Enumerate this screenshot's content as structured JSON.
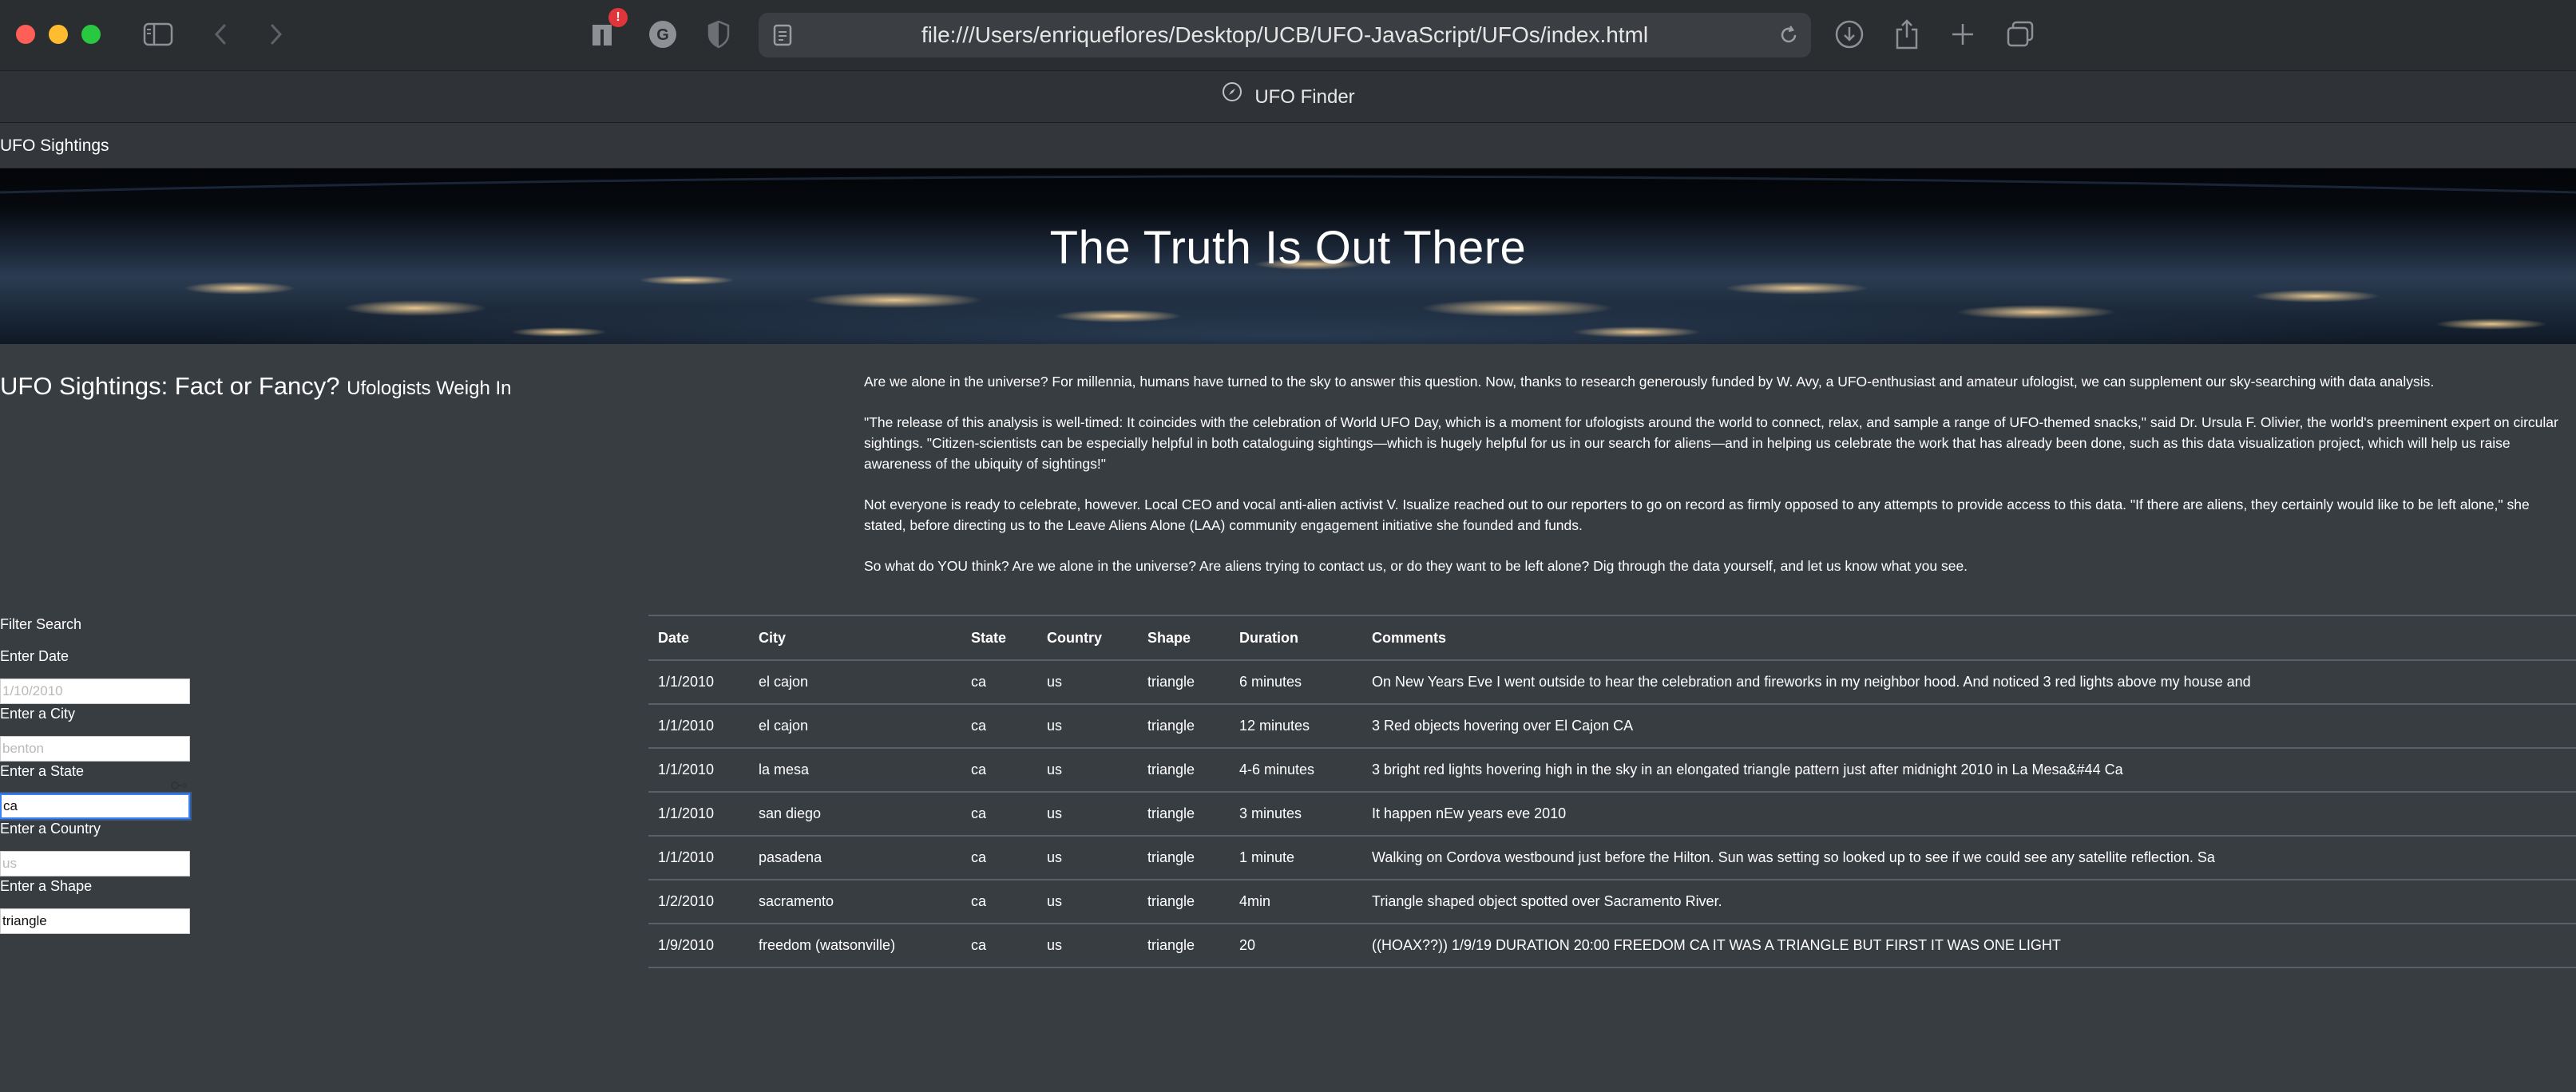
{
  "browser": {
    "url": "file:///Users/enriqueflores/Desktop/UCB/UFO-JavaScript/UFOs/index.html",
    "tab_title": "UFO Finder",
    "notification_badge": "!"
  },
  "navbar": {
    "brand": "UFO Sightings"
  },
  "hero": {
    "title": "The Truth Is Out There"
  },
  "article": {
    "title": "UFO Sightings: Fact or Fancy?",
    "subtitle": "Ufologists Weigh In",
    "paragraphs": [
      "Are we alone in the universe? For millennia, humans have turned to the sky to answer this question. Now, thanks to research generously funded by W. Avy, a UFO-enthusiast and amateur ufologist, we can supplement our sky-searching with data analysis.",
      "\"The release of this analysis is well-timed: It coincides with the celebration of World UFO Day, which is a moment for ufologists around the world to connect, relax, and sample a range of UFO-themed snacks,\" said Dr. Ursula F. Olivier, the world's preeminent expert on circular sightings. \"Citizen-scientists can be especially helpful in both cataloguing sightings—which is hugely helpful for us in our search for aliens—and in helping us celebrate the work that has already been done, such as this data visualization project, which will help us raise awareness of the ubiquity of sightings!\"",
      "Not everyone is ready to celebrate, however. Local CEO and vocal anti-alien activist V. Isualize reached out to our reporters to go on record as firmly opposed to any attempts to provide access to this data. \"If there are aliens, they certainly would like to be left alone,\" she stated, before directing us to the Leave Aliens Alone (LAA) community engagement initiative she founded and funds.",
      "So what do YOU think? Are we alone in the universe? Are aliens trying to contact us, or do they want to be left alone? Dig through the data yourself, and let us know what you see."
    ]
  },
  "filter": {
    "title": "Filter Search",
    "fields": [
      {
        "label": "Enter Date",
        "placeholder": "1/10/2010",
        "value": ""
      },
      {
        "label": "Enter a City",
        "placeholder": "benton",
        "value": ""
      },
      {
        "label": "Enter a State",
        "placeholder": "",
        "value": "ca"
      },
      {
        "label": "Enter a Country",
        "placeholder": "us",
        "value": ""
      },
      {
        "label": "Enter a Shape",
        "placeholder": "",
        "value": "triangle"
      }
    ]
  },
  "table": {
    "headers": [
      "Date",
      "City",
      "State",
      "Country",
      "Shape",
      "Duration",
      "Comments"
    ],
    "rows": [
      [
        "1/1/2010",
        "el cajon",
        "ca",
        "us",
        "triangle",
        "6 minutes",
        "On New Years Eve I went outside to hear the celebration and fireworks in my neighbor hood. And noticed 3 red lights above my house and"
      ],
      [
        "1/1/2010",
        "el cajon",
        "ca",
        "us",
        "triangle",
        "12 minutes",
        "3 Red objects hovering over El Cajon CA"
      ],
      [
        "1/1/2010",
        "la mesa",
        "ca",
        "us",
        "triangle",
        "4-6 minutes",
        "3 bright red lights hovering high in the sky in an elongated triangle pattern just after midnight 2010 in La Mesa&#44 Ca"
      ],
      [
        "1/1/2010",
        "san diego",
        "ca",
        "us",
        "triangle",
        "3 minutes",
        "It happen nEw years eve 2010"
      ],
      [
        "1/1/2010",
        "pasadena",
        "ca",
        "us",
        "triangle",
        "1 minute",
        "Walking on Cordova westbound just before the Hilton. Sun was setting so looked up to see if we could see any satellite reflection. Sa"
      ],
      [
        "1/2/2010",
        "sacramento",
        "ca",
        "us",
        "triangle",
        "4min",
        "Triangle shaped object spotted over Sacramento River."
      ],
      [
        "1/9/2010",
        "freedom (watsonville)",
        "ca",
        "us",
        "triangle",
        "20",
        "((HOAX??)) 1/9/19 DURATION 20:00 FREEDOM CA IT WAS A TRIANGLE BUT FIRST IT WAS ONE LIGHT"
      ]
    ]
  }
}
